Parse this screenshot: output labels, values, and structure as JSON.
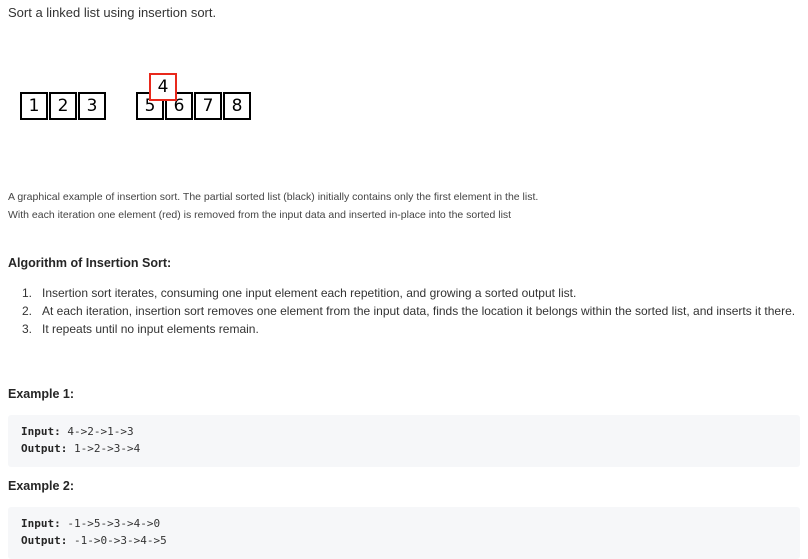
{
  "intro": "Sort a linked list using insertion sort.",
  "illustration": {
    "sorted": [
      "1",
      "2",
      "3"
    ],
    "unsorted": [
      "5",
      "6",
      "7",
      "8"
    ],
    "current": "4",
    "colors": {
      "sorted_border": "#000000",
      "current_border": "#e8291c"
    }
  },
  "captions": [
    "A graphical example of insertion sort. The partial sorted list (black) initially contains only the first element in the list.",
    "With each iteration one element (red) is removed from the input data and inserted in-place into the sorted list"
  ],
  "algorithm": {
    "heading": "Algorithm of Insertion Sort:",
    "steps": [
      {
        "num": "1.",
        "text": "Insertion sort iterates, consuming one input element each repetition, and growing a sorted output list."
      },
      {
        "num": "2.",
        "text": "At each iteration, insertion sort removes one element from the input data, finds the location it belongs within the sorted list, and inserts it there."
      },
      {
        "num": "3.",
        "text": "It repeats until no input elements remain."
      }
    ]
  },
  "examples": [
    {
      "heading": "Example 1:",
      "input_label": "Input:",
      "input": "4->2->1->3",
      "output_label": "Output:",
      "output": "1->2->3->4"
    },
    {
      "heading": "Example 2:",
      "input_label": "Input:",
      "input": "-1->5->3->4->0",
      "output_label": "Output:",
      "output": "-1->0->3->4->5"
    }
  ]
}
